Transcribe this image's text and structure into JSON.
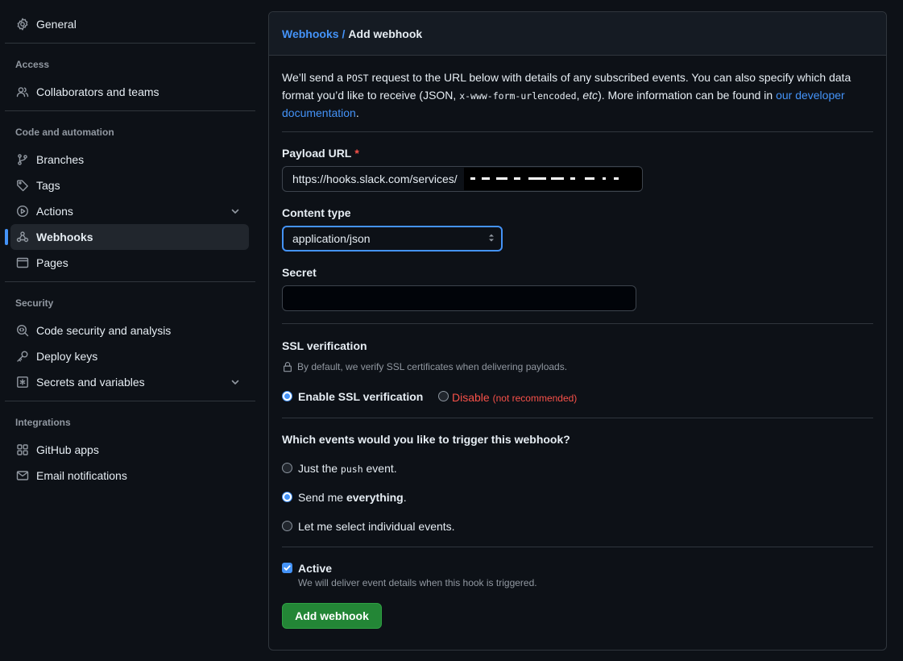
{
  "sidebar": {
    "general": "General",
    "sections": [
      {
        "title": "Access"
      },
      {
        "title": "Code and automation"
      },
      {
        "title": "Security"
      },
      {
        "title": "Integrations"
      }
    ],
    "items": {
      "collaborators": "Collaborators and teams",
      "branches": "Branches",
      "tags": "Tags",
      "actions": "Actions",
      "webhooks": "Webhooks",
      "pages": "Pages",
      "code_security": "Code security and analysis",
      "deploy_keys": "Deploy keys",
      "secrets": "Secrets and variables",
      "github_apps": "GitHub apps",
      "email_notifications": "Email notifications"
    },
    "active": "webhooks"
  },
  "breadcrumb": {
    "parent": "Webhooks",
    "separator": "/",
    "current": "Add webhook"
  },
  "intro": {
    "part1": "We’ll send a ",
    "method": "POST",
    "part2": " request to the URL below with details of any subscribed events. You can also specify which data format you’d like to receive (JSON, ",
    "format": "x-www-form-urlencoded",
    "part3": ", ",
    "etc": "etc",
    "part4": "). More information can be found in ",
    "link": "our developer documentation",
    "part5": "."
  },
  "form": {
    "payload_url_label": "Payload URL",
    "required_mark": "*",
    "payload_url_value": "https://hooks.slack.com/services/",
    "content_type_label": "Content type",
    "content_type_value": "application/json",
    "secret_label": "Secret",
    "secret_value": ""
  },
  "ssl": {
    "title": "SSL verification",
    "note": "By default, we verify SSL certificates when delivering payloads.",
    "enable_label": "Enable SSL verification",
    "disable_label": "Disable",
    "disable_note": "(not recommended)",
    "selected": "enable"
  },
  "events": {
    "question": "Which events would you like to trigger this webhook?",
    "options": [
      {
        "pre": "Just the ",
        "code": "push",
        "post": " event."
      },
      {
        "pre": "Send me ",
        "bold": "everything",
        "post": "."
      },
      {
        "pre": "Let me select individual events."
      }
    ],
    "selected_index": 1
  },
  "active": {
    "label": "Active",
    "checked": true,
    "note": "We will deliver event details when this hook is triggered."
  },
  "submit": {
    "label": "Add webhook"
  },
  "colors": {
    "background": "#0d1117",
    "accent": "#4493f8",
    "primary_button": "#238636",
    "danger": "#f85149",
    "border": "#30363d"
  }
}
